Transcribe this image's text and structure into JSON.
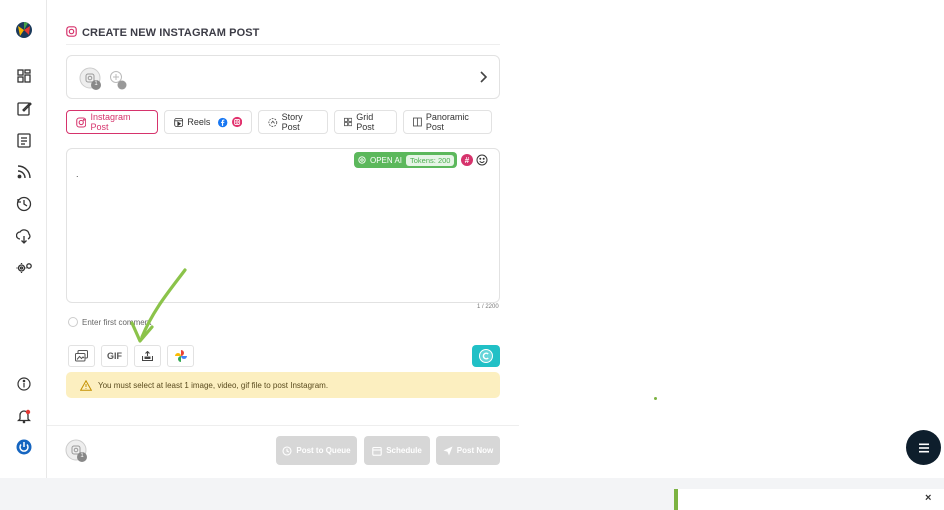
{
  "header": {
    "title": "CREATE NEW INSTAGRAM POST"
  },
  "account_selector": {
    "badge_count": "1"
  },
  "tabs": [
    {
      "label": "Instagram Post",
      "active": true
    },
    {
      "label": "Reels",
      "active": false
    },
    {
      "label": "Story Post",
      "active": false
    },
    {
      "label": "Grid Post",
      "active": false
    },
    {
      "label": "Panoramic Post",
      "active": false
    }
  ],
  "editor": {
    "openai_label": "OPEN AI",
    "tokens_label": "Tokens: 200",
    "hashtag_symbol": "#",
    "content": ".",
    "char_count": "1 / 2200"
  },
  "first_comment": {
    "placeholder": "Enter first comment"
  },
  "media_buttons": {
    "gif_label": "GIF"
  },
  "warning": {
    "text": "You must select at least 1 image, video, gif file to post Instagram."
  },
  "footer": {
    "badge_count": "1",
    "post_to_queue": "Post to Queue",
    "schedule": "Schedule",
    "post_now": "Post Now"
  },
  "colors": {
    "accent_pink": "#d6336c",
    "openai_green": "#5cb85c",
    "canva_teal": "#21c0c6",
    "warning_bg": "#fcefc0",
    "annotation_arrow": "#8bc34a",
    "fab_dark": "#0e1e2c"
  }
}
